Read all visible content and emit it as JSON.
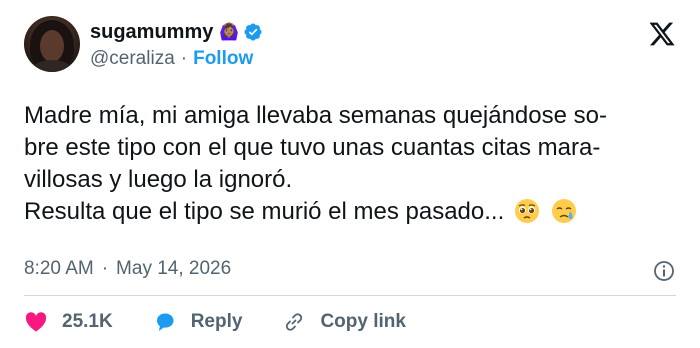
{
  "author": {
    "display_name": "sugamummy",
    "person_emoji": "🙆🏽‍♀️",
    "handle": "@ceraliza",
    "separator": "·",
    "follow_label": "Follow"
  },
  "tweet": {
    "lines": [
      "Madre mía, mi amiga llevaba semanas quejándose so-",
      "bre este tipo con el que tuvo unas cuantas citas mara-",
      "villosas y luego la ignoró.",
      "Resulta que el tipo se murió el mes pasado..."
    ],
    "emojis": [
      "pleading-face",
      "crying-face"
    ]
  },
  "meta": {
    "time": "8:20 AM",
    "separator": "·",
    "date": "May 14, 2026"
  },
  "actions": {
    "likes": "25.1K",
    "reply_label": "Reply",
    "copy_link_label": "Copy link"
  },
  "colors": {
    "text": "#0f1419",
    "muted": "#536471",
    "accent": "#1d9bf0",
    "like": "#f91880",
    "divider": "#cfd9de"
  },
  "icons": [
    "verified-badge-icon",
    "x-logo-icon",
    "info-icon",
    "heart-icon",
    "reply-icon",
    "link-icon"
  ]
}
